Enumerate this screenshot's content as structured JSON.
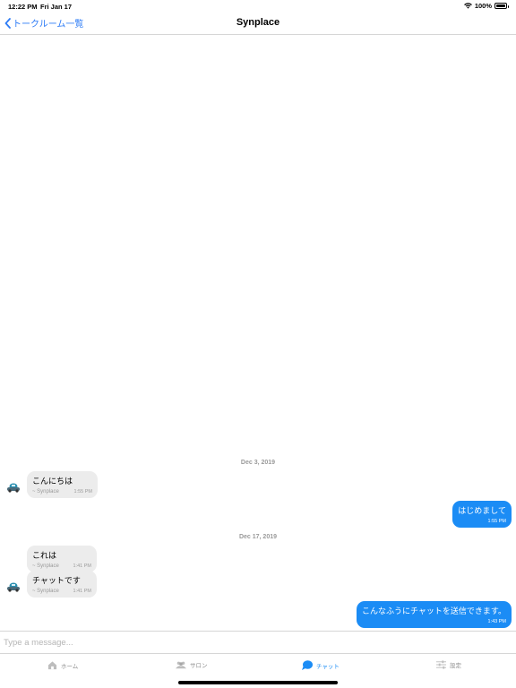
{
  "status_bar": {
    "time": "12:22 PM",
    "date": "Fri Jan 17",
    "battery": "100%"
  },
  "nav": {
    "back_label": "トークルーム一覧",
    "title": "Synplace"
  },
  "chat": {
    "date_separators": [
      "Dec 3, 2019",
      "Dec 17, 2019"
    ],
    "messages": [
      {
        "direction": "incoming",
        "text": "こんにちは",
        "sender": "~ Synplace",
        "time": "1:55 PM"
      },
      {
        "direction": "outgoing",
        "text": "はじめまして",
        "time": "1:55 PM"
      },
      {
        "direction": "incoming",
        "text": "これは",
        "sender": "~ Synplace",
        "time": "1:41 PM"
      },
      {
        "direction": "incoming",
        "text": "チャットです",
        "sender": "~ Synplace",
        "time": "1:41 PM"
      },
      {
        "direction": "outgoing",
        "text": "こんなふうにチャットを送信できます。",
        "time": "1:43 PM"
      }
    ]
  },
  "input": {
    "placeholder": "Type a message...",
    "value": ""
  },
  "tabs": [
    {
      "label": "ホーム",
      "icon": "home-icon",
      "active": false
    },
    {
      "label": "サロン",
      "icon": "people-icon",
      "active": false
    },
    {
      "label": "チャット",
      "icon": "chat-icon",
      "active": true
    },
    {
      "label": "設定",
      "icon": "settings-icon",
      "active": false
    }
  ],
  "colors": {
    "accent": "#1b8cf5",
    "incoming_bubble": "#ececec",
    "link": "#2e7cf6"
  }
}
